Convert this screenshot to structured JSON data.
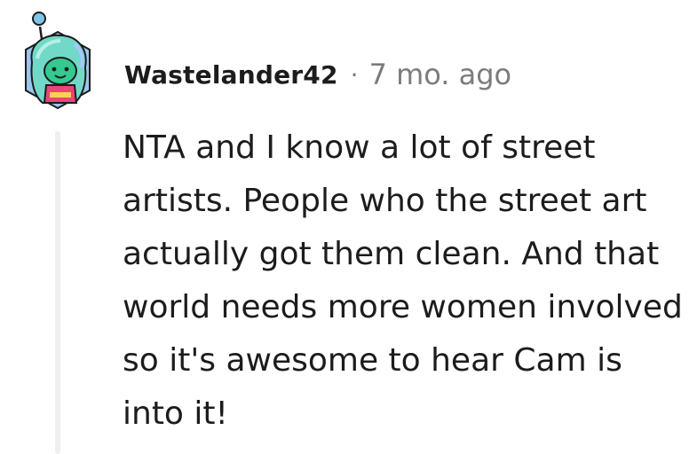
{
  "comment": {
    "author": "Wastelander42",
    "separator": "·",
    "timestamp": "7 mo. ago",
    "body": "NTA and I know a lot of street artists. People who the street art actually got them clean. And that world needs more women involved so it's awesome to hear Cam is into it!",
    "avatar_icon": "snoo-avatar-icon"
  },
  "colors": {
    "text": "#1c1c1c",
    "meta": "#7c7c7c",
    "thread_line": "#edeff1",
    "avatar_hair": "#6fd3c7",
    "avatar_face": "#3ecf9a",
    "avatar_badge": "#7fb2e5"
  }
}
